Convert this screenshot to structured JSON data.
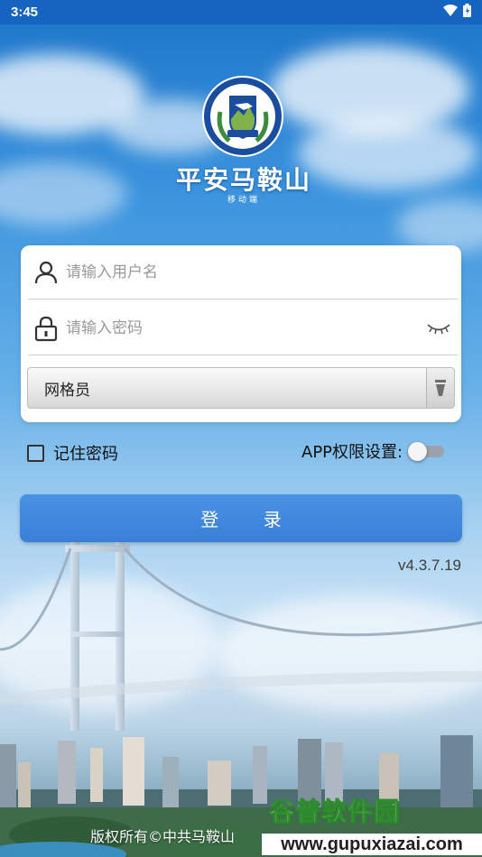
{
  "status_bar": {
    "time": "3:45",
    "icons": [
      "wifi-icon",
      "battery-icon"
    ]
  },
  "app": {
    "title": "平安马鞍山",
    "subtitle": "移动端",
    "logo_text": "平安马鞍山"
  },
  "login_form": {
    "username_placeholder": "请输入用户名",
    "password_placeholder": "请输入密码",
    "role_selected": "网格员"
  },
  "options": {
    "remember_label": "记住密码",
    "remember_checked": false,
    "permission_label": "APP权限设置:",
    "permission_enabled": false
  },
  "login_button": "登 录",
  "version": "v4.3.7.19",
  "footer": {
    "copyright": "版权所有©中共马鞍山"
  },
  "watermark": {
    "title": "谷普软件园",
    "url": "www.gupuxiazai.com"
  },
  "colors": {
    "status_bar": "#1565c0",
    "primary_button": "#3a7fd6",
    "card": "#ffffff"
  }
}
